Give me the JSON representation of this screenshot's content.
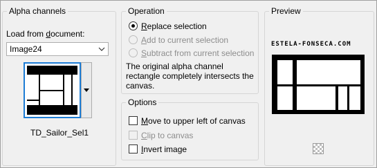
{
  "alpha": {
    "title": "Alpha channels",
    "load_label_pre": "Load from ",
    "load_label_ul": "d",
    "load_label_post": "ocument:",
    "document_value": "Image24",
    "selection_name": "TD_Sailor_Sel1"
  },
  "operation": {
    "title": "Operation",
    "options": [
      {
        "ul": "R",
        "rest": "eplace selection",
        "checked": true,
        "enabled": true
      },
      {
        "ul": "A",
        "rest": "dd to current selection",
        "checked": false,
        "enabled": false
      },
      {
        "ul": "S",
        "rest": "ubtract from current selection",
        "checked": false,
        "enabled": false
      }
    ],
    "description_line1": "The original alpha channel",
    "description_line2": "rectangle completely intersects the",
    "description_line3": "canvas."
  },
  "options": {
    "title": "Options",
    "items": [
      {
        "ul": "M",
        "rest": "ove to upper left of canvas",
        "checked": false,
        "enabled": true
      },
      {
        "ul": "C",
        "rest": "lip to canvas",
        "checked": false,
        "enabled": false
      },
      {
        "ul": "I",
        "rest": "nvert image",
        "checked": false,
        "enabled": true
      }
    ]
  },
  "preview": {
    "title": "Preview",
    "watermark": "ESTELA-FONSECA.COM"
  },
  "colors": {
    "accent": "#1c7cd5",
    "disabled_text": "#8d8d8d"
  }
}
